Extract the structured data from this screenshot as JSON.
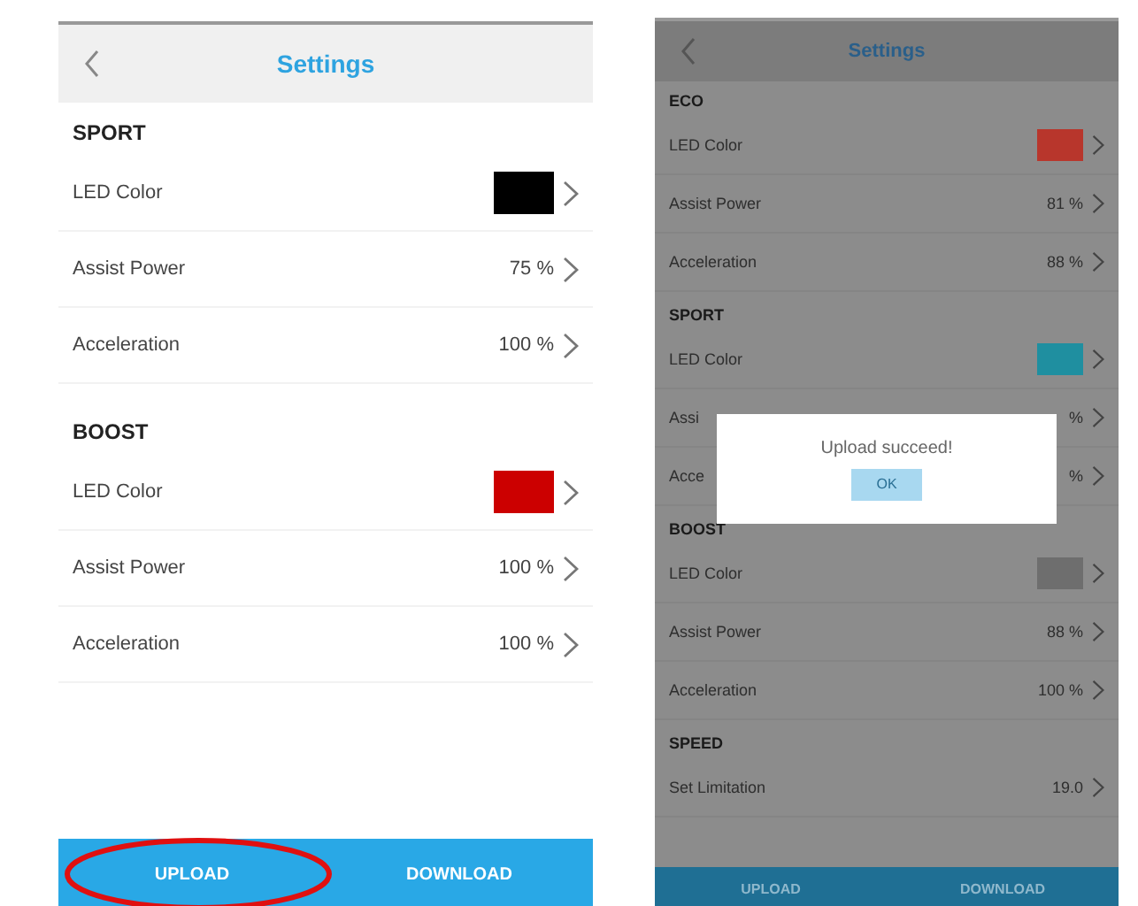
{
  "screens": [
    {
      "dimmed": false,
      "title": "Settings",
      "sections": [
        {
          "title": "SPORT",
          "rows": [
            {
              "kind": "color",
              "label": "LED Color",
              "color": "#000000"
            },
            {
              "kind": "value",
              "label": "Assist Power",
              "value": "75 %"
            },
            {
              "kind": "value",
              "label": "Acceleration",
              "value": "100 %"
            }
          ]
        },
        {
          "title": "BOOST",
          "rows": [
            {
              "kind": "color",
              "label": "LED Color",
              "color": "#cc0000"
            },
            {
              "kind": "value",
              "label": "Assist Power",
              "value": "100 %"
            },
            {
              "kind": "value",
              "label": "Acceleration",
              "value": "100 %"
            }
          ]
        }
      ],
      "buttons": [
        {
          "label": "UPLOAD",
          "highlighted": true
        },
        {
          "label": "DOWNLOAD",
          "highlighted": false
        }
      ]
    },
    {
      "dimmed": true,
      "title": "Settings",
      "sections": [
        {
          "title": "ECO",
          "rows": [
            {
              "kind": "color",
              "label": "LED Color",
              "color": "#b8362c"
            },
            {
              "kind": "value",
              "label": "Assist Power",
              "value": "81 %"
            },
            {
              "kind": "value",
              "label": "Acceleration",
              "value": "88 %"
            }
          ]
        },
        {
          "title": "SPORT",
          "rows": [
            {
              "kind": "color",
              "label": "LED Color",
              "color": "#1f8fa0"
            },
            {
              "kind": "value",
              "label": "Assi",
              "value": "%"
            },
            {
              "kind": "value",
              "label": "Acce",
              "value": "%"
            }
          ]
        },
        {
          "title": "BOOST",
          "rows": [
            {
              "kind": "color",
              "label": "LED Color",
              "color": "#6e6e6e"
            },
            {
              "kind": "value",
              "label": "Assist Power",
              "value": "88 %"
            },
            {
              "kind": "value",
              "label": "Acceleration",
              "value": "100 %"
            }
          ]
        },
        {
          "title": "SPEED",
          "rows": [
            {
              "kind": "value",
              "label": "Set Limitation",
              "value": "19.0"
            }
          ]
        }
      ],
      "dialog": {
        "message": "Upload succeed!",
        "button": "OK"
      },
      "buttons": [
        {
          "label": "UPLOAD",
          "highlighted": false
        },
        {
          "label": "DOWNLOAD",
          "highlighted": false
        }
      ]
    }
  ]
}
